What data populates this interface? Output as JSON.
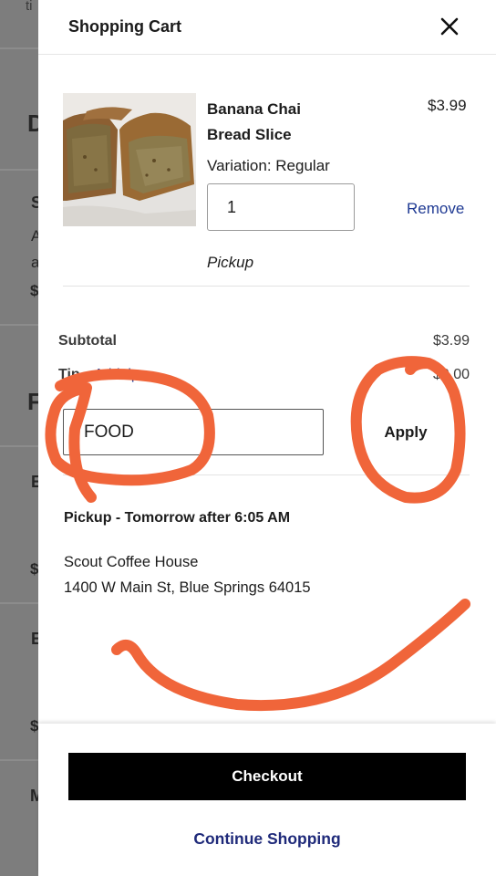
{
  "background": {
    "chars": [
      "ti",
      "D",
      "S",
      "A",
      "a",
      "$",
      "F",
      "E",
      "$",
      "E",
      "$",
      "M"
    ]
  },
  "cart": {
    "title": "Shopping Cart",
    "close_icon": "close-icon",
    "item": {
      "name": "Banana Chai Bread Slice",
      "price": "$3.99",
      "variation": "Variation: Regular",
      "quantity": "1",
      "remove_label": "Remove",
      "fulfillment": "Pickup"
    },
    "subtotal_label": "Subtotal",
    "subtotal_value": "$3.99",
    "tip_label": "Tip",
    "add_tip_label": "Add tip",
    "tip_value": "$0.00",
    "coupon_value": "FOOD",
    "apply_label": "Apply",
    "pickup_heading": "Pickup - Tomorrow after 6:05 AM",
    "store_name": "Scout Coffee House",
    "store_address": "1400 W Main St, Blue Springs 64015",
    "checkout_label": "Checkout",
    "continue_label": "Continue Shopping"
  },
  "colors": {
    "link": "#1f3a93",
    "annotation": "#f0653a",
    "checkout_bg": "#000000",
    "overlay": "#7d7d7d"
  }
}
